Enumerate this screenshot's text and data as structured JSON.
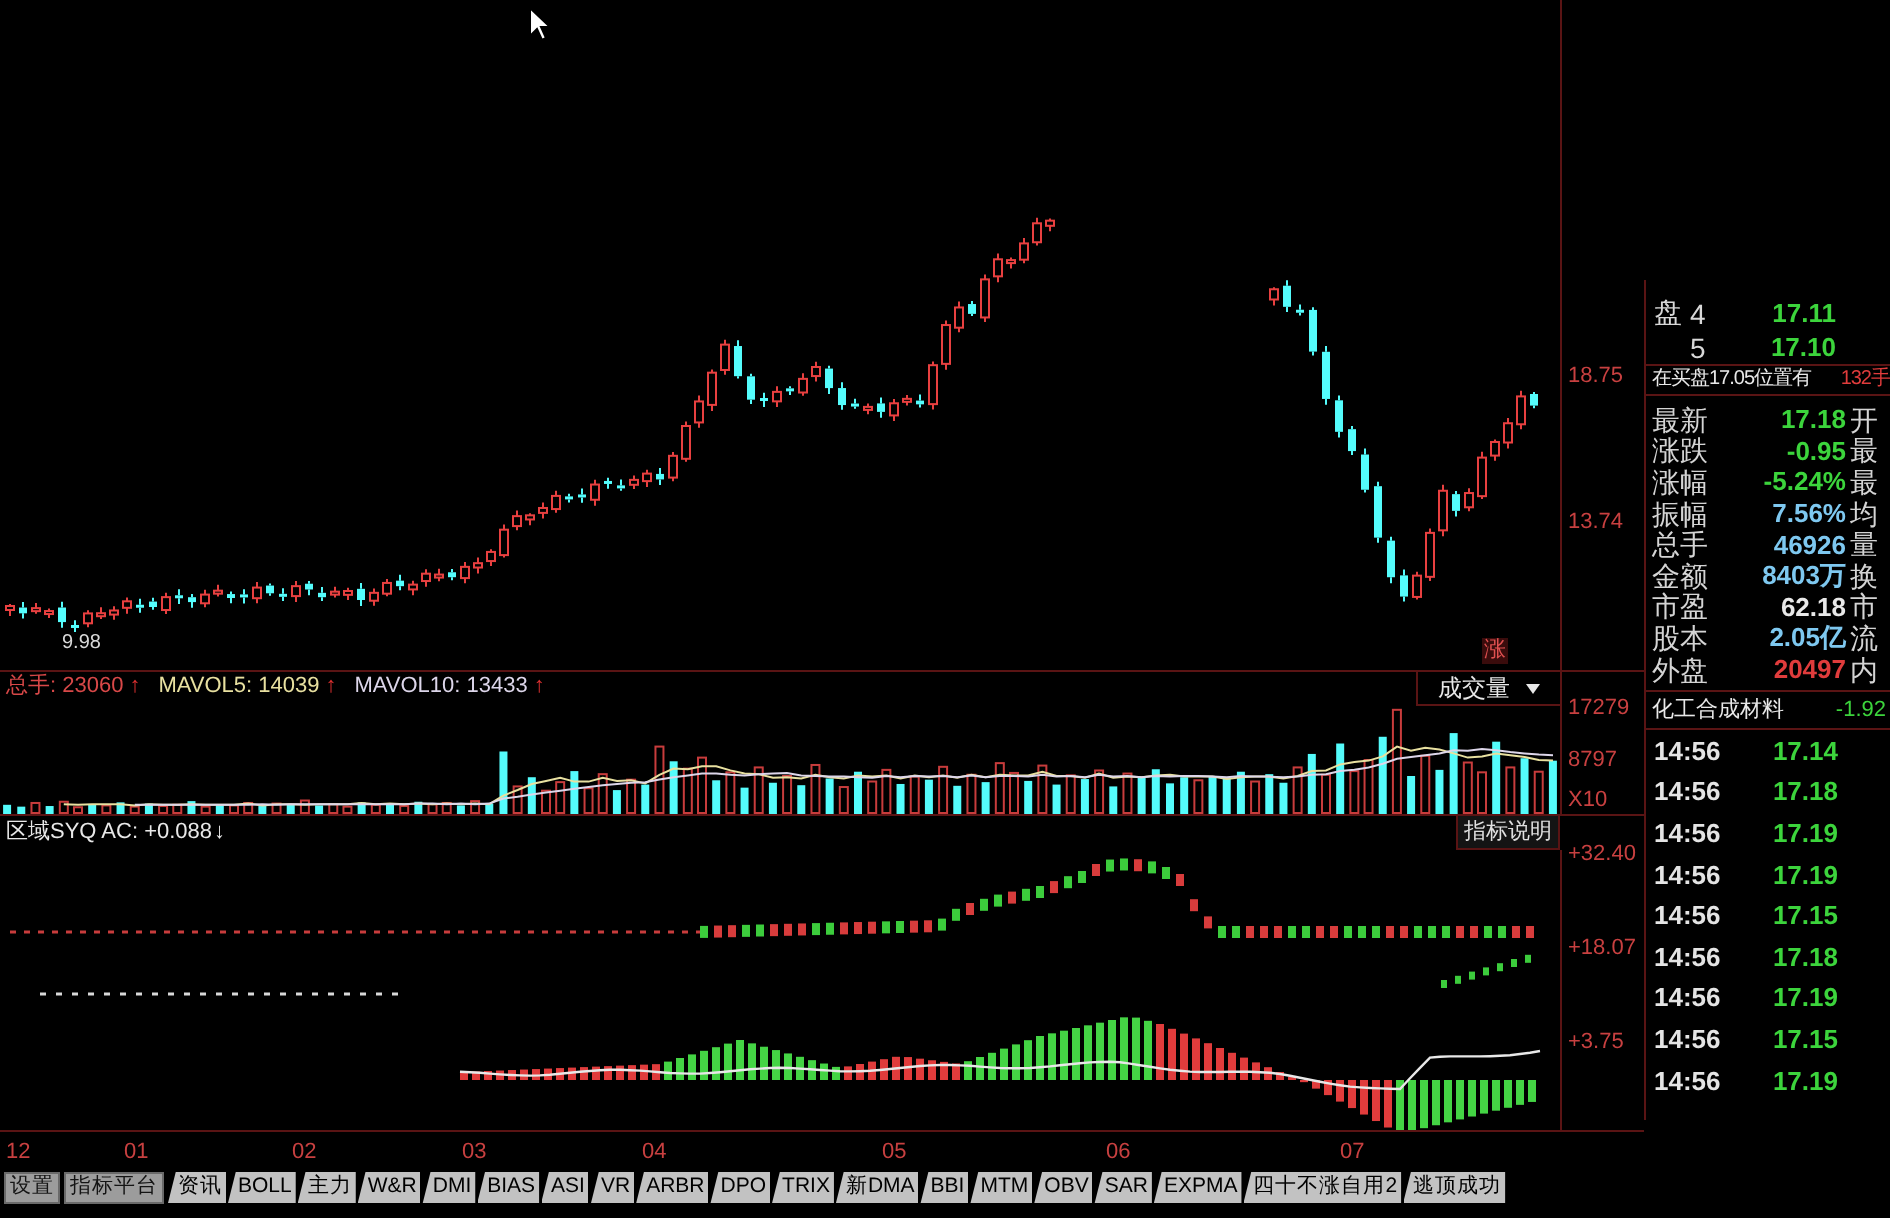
{
  "price_chart": {
    "axis_labels": [
      "18.75",
      "13.74"
    ],
    "low_label": "9.98",
    "marker": "涨"
  },
  "volume_panel": {
    "legend": [
      {
        "text": "总手: 23060",
        "arrow": "↑",
        "color": "#d84848"
      },
      {
        "text": "MAVOL5: 14039",
        "arrow": "↑",
        "color": "#e8e0a0"
      },
      {
        "text": "MAVOL10: 13433",
        "arrow": "↑",
        "color": "#ddd6ea"
      }
    ],
    "selector": "成交量",
    "unit_label": "X10",
    "chart_data": {
      "type": "line",
      "ylim": [
        0,
        18600
      ],
      "yticks": [
        {
          "value": 17279,
          "label": "17279"
        },
        {
          "value": 8797,
          "label": "8797"
        }
      ],
      "series": [
        {
          "color": "#e8e0a0",
          "values": [
            null,
            null,
            null,
            null,
            1600,
            1500,
            1600,
            1600,
            1600,
            1400,
            1600,
            1500,
            1500,
            1600,
            1500,
            1500,
            1500,
            1700,
            1400,
            1600,
            1600,
            1500,
            1600,
            1600,
            1600,
            1800,
            1600,
            1700,
            1600,
            1700,
            1600,
            1700,
            1600,
            1700,
            1600,
            3000,
            3900,
            4900,
            5400,
            5900,
            5300,
            5300,
            5900,
            5400,
            5500,
            5000,
            6400,
            7400,
            7300,
            7800,
            7800,
            7100,
            6600,
            6500,
            5900,
            6000,
            5800,
            6400,
            6000,
            5800,
            6300,
            6100,
            6300,
            5800,
            6300,
            6000,
            6300,
            5900,
            6400,
            6000,
            6400,
            6300,
            6300,
            6900,
            6200,
            6200,
            5900,
            6600,
            5900,
            6100,
            6000,
            6300,
            6400,
            6100,
            6100,
            6100,
            5700,
            6000,
            6100,
            6100,
            5800,
            6200,
            7000,
            7100,
            8100,
            8500,
            8700,
            9400,
            11000,
            10300,
            10800,
            10500,
            9900,
            9200,
            9400,
            9900,
            9600,
            9300,
            8800,
            8700
          ]
        },
        {
          "color": "#ddd6ea",
          "values": [
            null,
            null,
            null,
            null,
            null,
            null,
            null,
            null,
            null,
            1500,
            1500,
            1500,
            1500,
            1500,
            1500,
            1500,
            1500,
            1500,
            1600,
            1500,
            1600,
            1600,
            1600,
            1600,
            1600,
            1600,
            1600,
            1600,
            1600,
            1700,
            1700,
            1600,
            1700,
            1600,
            1700,
            2500,
            2800,
            3200,
            3500,
            3800,
            4100,
            4400,
            4700,
            4900,
            5100,
            5200,
            5600,
            6000,
            6300,
            6600,
            6600,
            6400,
            6300,
            6500,
            6600,
            6700,
            6300,
            6200,
            6100,
            6100,
            6000,
            5900,
            6200,
            6000,
            6200,
            6100,
            6200,
            6000,
            6300,
            6000,
            6200,
            6200,
            6100,
            6400,
            6100,
            6200,
            6000,
            6400,
            6100,
            6200,
            6000,
            6200,
            6100,
            6200,
            6200,
            6100,
            6000,
            6200,
            6100,
            6100,
            6000,
            6100,
            6400,
            6500,
            7000,
            7200,
            7600,
            8200,
            9000,
            9300,
            9600,
            9900,
            10400,
            10300,
            10600,
            10400,
            10100,
            9900,
            9700,
            9600
          ]
        }
      ]
    }
  },
  "indicator_panel": {
    "legend": {
      "text": "区域SYQ AC: +0.088",
      "arrow": "↓"
    },
    "help_button": "指标说明",
    "axis_labels": [
      "+32.40",
      "+18.07",
      "+3.75"
    ]
  },
  "time_axis": [
    "12",
    "01",
    "02",
    "03",
    "04",
    "05",
    "06",
    "07"
  ],
  "tabs": [
    {
      "label": "设置",
      "kind": "button",
      "selected": false
    },
    {
      "label": "指标平台",
      "kind": "button",
      "selected": false
    },
    {
      "label": "资讯",
      "kind": "tab",
      "selected": false
    },
    {
      "label": "BOLL",
      "kind": "tab",
      "selected": false
    },
    {
      "label": "主力",
      "kind": "tab",
      "selected": false
    },
    {
      "label": "W&R",
      "kind": "tab",
      "selected": false
    },
    {
      "label": "DMI",
      "kind": "tab",
      "selected": false
    },
    {
      "label": "BIAS",
      "kind": "tab",
      "selected": false
    },
    {
      "label": "ASI",
      "kind": "tab",
      "selected": false
    },
    {
      "label": "VR",
      "kind": "tab",
      "selected": false
    },
    {
      "label": "ARBR",
      "kind": "tab",
      "selected": false
    },
    {
      "label": "DPO",
      "kind": "tab",
      "selected": false
    },
    {
      "label": "TRIX",
      "kind": "tab",
      "selected": false
    },
    {
      "label": "新DMA",
      "kind": "tab",
      "selected": false
    },
    {
      "label": "BBI",
      "kind": "tab",
      "selected": false
    },
    {
      "label": "MTM",
      "kind": "tab",
      "selected": false
    },
    {
      "label": "OBV",
      "kind": "tab",
      "selected": false
    },
    {
      "label": "SAR",
      "kind": "tab",
      "selected": false
    },
    {
      "label": "EXPMA",
      "kind": "tab",
      "selected": false
    },
    {
      "label": "四十不涨自用2",
      "kind": "tab",
      "selected": false
    },
    {
      "label": "逃顶成功",
      "kind": "tab",
      "selected": false
    }
  ],
  "quote_panel": {
    "ask_label": "盘",
    "asks": [
      {
        "level": "4",
        "price": "17.11"
      },
      {
        "level": "5",
        "price": "17.10"
      }
    ],
    "bid_notice": {
      "text": "在买盘17.05位置有",
      "volume": "132手"
    },
    "fields": [
      {
        "label": "最新",
        "value": "17.18",
        "color": "#3cd43c",
        "side_label": "开"
      },
      {
        "label": "涨跌",
        "value": "-0.95",
        "color": "#3cd43c",
        "side_label": "最"
      },
      {
        "label": "涨幅",
        "value": "-5.24%",
        "color": "#3cd43c",
        "side_label": "最"
      },
      {
        "label": "振幅",
        "value": "7.56%",
        "color": "#7ec8f0",
        "side_label": "均"
      },
      {
        "label": "总手",
        "value": "46926",
        "color": "#7ec8f0",
        "side_label": "量"
      },
      {
        "label": "金额",
        "value": "8403万",
        "color": "#7ec8f0",
        "side_label": "换"
      },
      {
        "label": "市盈",
        "value": "62.18",
        "color": "#e8e8e8",
        "side_label": "市"
      },
      {
        "label": "股本",
        "value": "2.05亿",
        "color": "#7ec8f0",
        "side_label": "流"
      },
      {
        "label": "外盘",
        "value": "20497",
        "color": "#e03c3c",
        "side_label": "内"
      }
    ],
    "sector": {
      "name": "化工合成材料",
      "change": "-1.92"
    },
    "ticks": [
      {
        "time": "14:56",
        "price": "17.14"
      },
      {
        "time": "14:56",
        "price": "17.18"
      },
      {
        "time": "14:56",
        "price": "17.19"
      },
      {
        "time": "14:56",
        "price": "17.19"
      },
      {
        "time": "14:56",
        "price": "17.15"
      },
      {
        "time": "14:56",
        "price": "17.18"
      },
      {
        "time": "14:56",
        "price": "17.19"
      },
      {
        "time": "14:56",
        "price": "17.15"
      },
      {
        "time": "14:56",
        "price": "17.19"
      }
    ]
  }
}
